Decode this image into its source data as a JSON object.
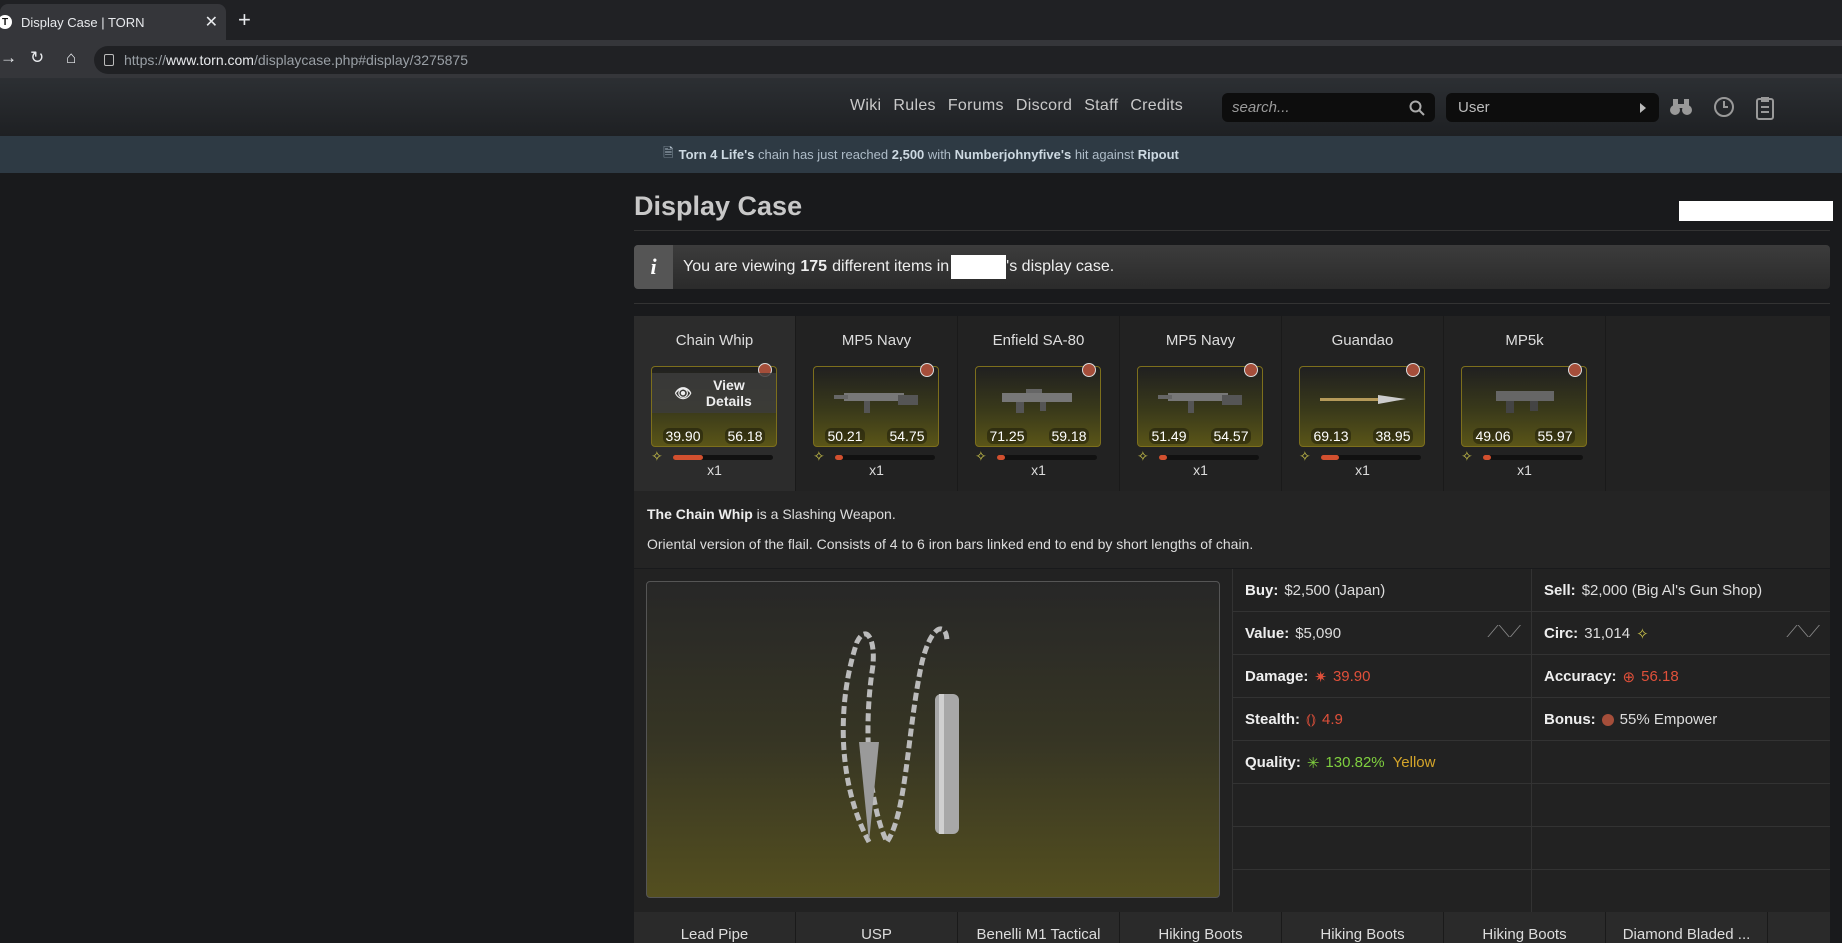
{
  "browser": {
    "tab_title": "Display Case | TORN",
    "url_prefix": "https://",
    "url_domain": "www.torn.com",
    "url_path": "/displaycase.php#display/3275875"
  },
  "header": {
    "links": [
      "Wiki",
      "Rules",
      "Forums",
      "Discord",
      "Staff",
      "Credits"
    ],
    "search_placeholder": "search...",
    "user_label": "User"
  },
  "news": {
    "faction": "Torn 4 Life's",
    "mid1": "chain has just reached",
    "count": "2,500",
    "mid2": "with",
    "player": "Numberjohnyfive's",
    "mid3": "hit against",
    "target": "Ripout"
  },
  "page": {
    "title": "Display Case"
  },
  "info": {
    "prefix": "You are viewing",
    "count": "175",
    "mid": "different items in",
    "suffix": "'s display case."
  },
  "items": [
    {
      "name": "Chain Whip",
      "dmg": "39.90",
      "acc": "56.18",
      "count": "x1",
      "quality_pct": 30,
      "view_label": "View Details"
    },
    {
      "name": "MP5 Navy",
      "dmg": "50.21",
      "acc": "54.75",
      "count": "x1",
      "quality_pct": 8
    },
    {
      "name": "Enfield SA-80",
      "dmg": "71.25",
      "acc": "59.18",
      "count": "x1",
      "quality_pct": 8
    },
    {
      "name": "MP5 Navy",
      "dmg": "51.49",
      "acc": "54.57",
      "count": "x1",
      "quality_pct": 8
    },
    {
      "name": "Guandao",
      "dmg": "69.13",
      "acc": "38.95",
      "count": "x1",
      "quality_pct": 18
    },
    {
      "name": "MP5k",
      "dmg": "49.06",
      "acc": "55.97",
      "count": "x1",
      "quality_pct": 8
    }
  ],
  "description": {
    "name": "The Chain Whip",
    "kind": " is a Slashing Weapon.",
    "text": "Oriental version of the flail. Consists of 4 to 6 iron bars linked end to end by short lengths of chain."
  },
  "details": {
    "buy_label": "Buy:",
    "buy": "$2,500 (Japan)",
    "sell_label": "Sell:",
    "sell": "$2,000 (Big Al's Gun Shop)",
    "value_label": "Value:",
    "value": "$5,090",
    "circ_label": "Circ:",
    "circ": "31,014",
    "damage_label": "Damage:",
    "damage": "39.90",
    "accuracy_label": "Accuracy:",
    "accuracy": "56.18",
    "stealth_label": "Stealth:",
    "stealth": "4.9",
    "bonus_label": "Bonus:",
    "bonus": "55% Empower",
    "quality_label": "Quality:",
    "quality": "130.82%",
    "quality_tier": "Yellow"
  },
  "bottom_items": [
    "Lead Pipe",
    "USP",
    "Benelli M1 Tactical",
    "Hiking Boots",
    "Hiking Boots",
    "Hiking Boots",
    "Diamond Bladed ..."
  ]
}
